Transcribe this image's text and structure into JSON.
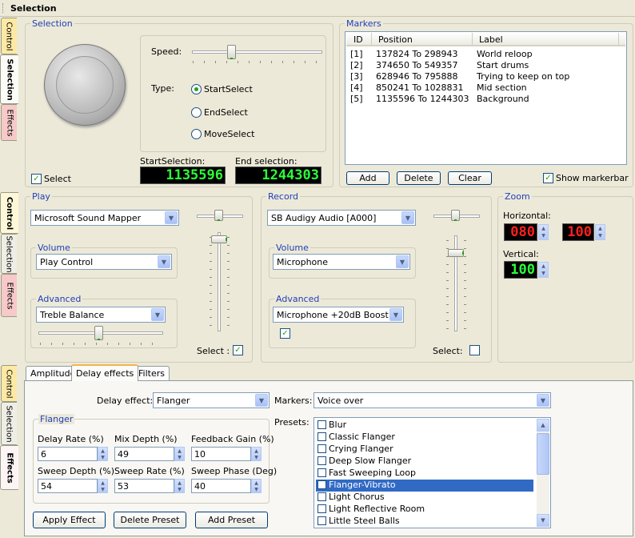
{
  "window": {
    "title": "Selection"
  },
  "sidebar": {
    "top_tabs": [
      "Control",
      "Selection",
      "Effects"
    ],
    "mid_tabs": [
      "Control",
      "Selection",
      "Effects"
    ],
    "bottom_tabs": [
      "Control",
      "Selection",
      "Effects"
    ]
  },
  "selection": {
    "group_label": "Selection",
    "speed_label": "Speed:",
    "speed_value": 0.3,
    "type_label": "Type:",
    "types": [
      "StartSelect",
      "EndSelect",
      "MoveSelect"
    ],
    "selected_type": "StartSelect",
    "select_label": "Select",
    "select_checked": true,
    "start_label": "StartSelection:",
    "start_value": "1135596",
    "end_label": "End selection:",
    "end_value": "1244303"
  },
  "markers": {
    "group_label": "Markers",
    "columns": [
      "ID",
      "Position",
      "Label"
    ],
    "rows": [
      {
        "id": "[1]",
        "position": "137824 To 298943",
        "label": "World reloop"
      },
      {
        "id": "[2]",
        "position": "374650 To 549357",
        "label": "Start drums"
      },
      {
        "id": "[3]",
        "position": "628946 To 795888",
        "label": "Trying to keep on top"
      },
      {
        "id": "[4]",
        "position": "850241 To 1028831",
        "label": "Mid section"
      },
      {
        "id": "[5]",
        "position": "1135596 To 1244303",
        "label": "Background"
      }
    ],
    "add_label": "Add",
    "delete_label": "Delete",
    "clear_label": "Clear",
    "show_markerbar_label": "Show markerbar",
    "show_markerbar_checked": true
  },
  "play": {
    "group_label": "Play",
    "device": "Microsoft Sound Mapper",
    "volume_label": "Volume",
    "volume_value": "Play Control",
    "advanced_label": "Advanced",
    "advanced_value": "Treble Balance",
    "select_label": "Select :",
    "select_checked": true
  },
  "record": {
    "group_label": "Record",
    "device": "SB Audigy Audio [A000]",
    "volume_label": "Volume",
    "volume_value": "Microphone",
    "advanced_label": "Advanced",
    "advanced_value": "Microphone +20dB Boost",
    "advanced_checked": true,
    "select_label": "Select:",
    "select_checked": false
  },
  "zoom": {
    "group_label": "Zoom",
    "horizontal_label": "Horizontal:",
    "horizontal_value_1": "080",
    "horizontal_value_2": "100",
    "vertical_label": "Vertical:",
    "vertical_value": "100"
  },
  "effects": {
    "tabs": [
      "Amplitude",
      "Delay effects",
      "Filters"
    ],
    "active_tab": "Delay effects",
    "delay_effect_label": "Delay effect:",
    "delay_effect_value": "Flanger",
    "markers_label": "Markers:",
    "markers_value": "Voice over",
    "flanger_label": "Flanger",
    "fields": [
      {
        "label": "Delay Rate (%)",
        "value": "6"
      },
      {
        "label": "Mix Depth (%)",
        "value": "49"
      },
      {
        "label": "Feedback Gain (%)",
        "value": "10"
      },
      {
        "label": "Sweep Depth (%)",
        "value": "54"
      },
      {
        "label": "Sweep Rate (%)",
        "value": "53"
      },
      {
        "label": "Sweep Phase (Deg)",
        "value": "40"
      }
    ],
    "presets_label": "Presets:",
    "presets": [
      "Blur",
      "Classic Flanger",
      "Crying Flanger",
      "Deep Slow Flanger",
      "Fast Sweeping Loop",
      "Flanger-Vibrato",
      "Light Chorus",
      "Light Reflective Room",
      "Little Steel Balls"
    ],
    "selected_preset": "Flanger-Vibrato",
    "apply_label": "Apply Effect",
    "delete_label": "Delete Preset",
    "add_label": "Add Preset"
  },
  "colors": {
    "accent": "#1f3fb8",
    "lcd_green": "#2bff3a",
    "lcd_red": "#ff2020",
    "selection": "#316ac5",
    "checkmark": "#21a121"
  }
}
